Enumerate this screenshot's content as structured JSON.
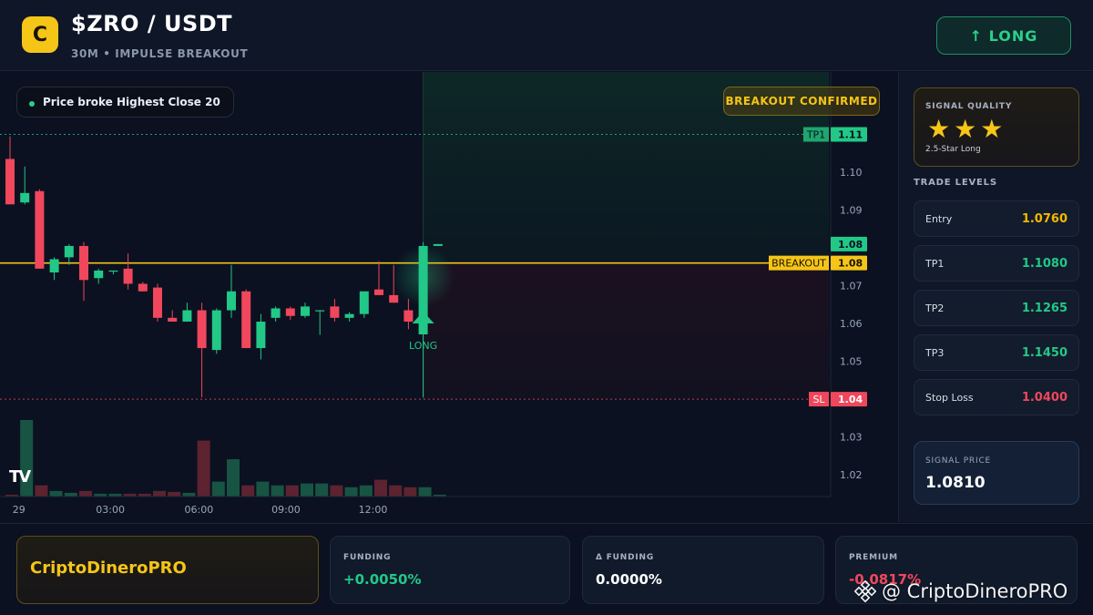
{
  "header": {
    "logo_letter": "C",
    "title": "$ZRO / USDT",
    "subtitle": "30M • IMPULSE BREAKOUT",
    "long_button": "↑ LONG"
  },
  "chart": {
    "pill_text": "Price broke Highest Close 20",
    "confirmed_badge": "BREAKOUT CONFIRMED",
    "signal_label": "LONG",
    "tv_logo": "TV",
    "colors": {
      "up": "#22c887",
      "down": "#f0475c",
      "breakout": "#f5c518"
    }
  },
  "chart_data": {
    "type": "candlestick",
    "x_ticks": [
      "29",
      "03:00",
      "06:00",
      "09:00",
      "12:00"
    ],
    "y_ticks": [
      "1.10",
      "1.09",
      "1.07",
      "1.06",
      "1.05",
      "1.03",
      "1.02"
    ],
    "ylim": [
      1.0075,
      1.1265
    ],
    "levels": [
      {
        "label": "TP1",
        "value": 1.11,
        "value_text": "1.11",
        "color": "#22c887",
        "style": "dotted"
      },
      {
        "label": "BREAKOUT",
        "value": 1.076,
        "value_text": "1.08",
        "color": "#f5c518",
        "style": "solid"
      },
      {
        "label": "SL",
        "value": 1.04,
        "value_text": "1.04",
        "color": "#f0475c",
        "style": "dotted"
      }
    ],
    "last_price_tag": {
      "value": 1.081,
      "value_text": "1.08"
    },
    "candles": [
      {
        "o": 1.1035,
        "h": 1.1095,
        "l": 1.0915,
        "c": 1.0915
      },
      {
        "o": 1.092,
        "h": 1.1015,
        "l": 1.0915,
        "c": 1.0945
      },
      {
        "o": 1.095,
        "h": 1.0955,
        "l": 1.0745,
        "c": 1.0745
      },
      {
        "o": 1.0735,
        "h": 1.0775,
        "l": 1.0715,
        "c": 1.077
      },
      {
        "o": 1.0775,
        "h": 1.081,
        "l": 1.0755,
        "c": 1.0805
      },
      {
        "o": 1.0805,
        "h": 1.0815,
        "l": 1.066,
        "c": 1.0715
      },
      {
        "o": 1.072,
        "h": 1.0745,
        "l": 1.0705,
        "c": 1.074
      },
      {
        "o": 1.074,
        "h": 1.074,
        "l": 1.073,
        "c": 1.074
      },
      {
        "o": 1.0745,
        "h": 1.0785,
        "l": 1.069,
        "c": 1.0705
      },
      {
        "o": 1.0705,
        "h": 1.071,
        "l": 1.0685,
        "c": 1.0685
      },
      {
        "o": 1.0695,
        "h": 1.0705,
        "l": 1.0605,
        "c": 1.0615
      },
      {
        "o": 1.0615,
        "h": 1.0635,
        "l": 1.0605,
        "c": 1.0605
      },
      {
        "o": 1.0605,
        "h": 1.0655,
        "l": 1.0605,
        "c": 1.0635
      },
      {
        "o": 1.0635,
        "h": 1.0655,
        "l": 1.0405,
        "c": 1.0535
      },
      {
        "o": 1.053,
        "h": 1.064,
        "l": 1.052,
        "c": 1.0635
      },
      {
        "o": 1.0635,
        "h": 1.0755,
        "l": 1.0615,
        "c": 1.0685
      },
      {
        "o": 1.0685,
        "h": 1.069,
        "l": 1.0535,
        "c": 1.0535
      },
      {
        "o": 1.0535,
        "h": 1.0625,
        "l": 1.0505,
        "c": 1.0605
      },
      {
        "o": 1.0615,
        "h": 1.0645,
        "l": 1.0605,
        "c": 1.064
      },
      {
        "o": 1.064,
        "h": 1.0645,
        "l": 1.061,
        "c": 1.062
      },
      {
        "o": 1.062,
        "h": 1.0655,
        "l": 1.0615,
        "c": 1.0645
      },
      {
        "o": 1.0635,
        "h": 1.0635,
        "l": 1.057,
        "c": 1.0635
      },
      {
        "o": 1.0645,
        "h": 1.0665,
        "l": 1.0605,
        "c": 1.0615
      },
      {
        "o": 1.0615,
        "h": 1.063,
        "l": 1.0605,
        "c": 1.0625
      },
      {
        "o": 1.0625,
        "h": 1.0685,
        "l": 1.0615,
        "c": 1.0685
      },
      {
        "o": 1.069,
        "h": 1.0765,
        "l": 1.0675,
        "c": 1.0675
      },
      {
        "o": 1.0675,
        "h": 1.0755,
        "l": 1.0655,
        "c": 1.0655
      },
      {
        "o": 1.0635,
        "h": 1.0665,
        "l": 1.0585,
        "c": 1.0605
      },
      {
        "o": 1.0615,
        "h": 1.0815,
        "l": 1.0405,
        "c": 1.0805
      },
      {
        "o": 1.0805,
        "h": 1.081,
        "l": 1.0805,
        "c": 1.081
      }
    ],
    "volume": [
      {
        "v": 2,
        "up": false
      },
      {
        "v": 82,
        "up": true
      },
      {
        "v": 12,
        "up": false
      },
      {
        "v": 6,
        "up": true
      },
      {
        "v": 4,
        "up": true
      },
      {
        "v": 6,
        "up": false
      },
      {
        "v": 3,
        "up": true
      },
      {
        "v": 3,
        "up": true
      },
      {
        "v": 3,
        "up": false
      },
      {
        "v": 3,
        "up": false
      },
      {
        "v": 6,
        "up": false
      },
      {
        "v": 5,
        "up": false
      },
      {
        "v": 4,
        "up": true
      },
      {
        "v": 60,
        "up": false
      },
      {
        "v": 16,
        "up": true
      },
      {
        "v": 40,
        "up": true
      },
      {
        "v": 12,
        "up": false
      },
      {
        "v": 16,
        "up": true
      },
      {
        "v": 12,
        "up": true
      },
      {
        "v": 12,
        "up": false
      },
      {
        "v": 14,
        "up": true
      },
      {
        "v": 14,
        "up": true
      },
      {
        "v": 12,
        "up": false
      },
      {
        "v": 10,
        "up": true
      },
      {
        "v": 12,
        "up": true
      },
      {
        "v": 18,
        "up": false
      },
      {
        "v": 12,
        "up": false
      },
      {
        "v": 10,
        "up": false
      },
      {
        "v": 10,
        "up": true
      },
      {
        "v": 2,
        "up": true
      }
    ]
  },
  "sidebar": {
    "quality_label": "SIGNAL QUALITY",
    "stars": "★★★",
    "quality_sub": "2.5-Star Long",
    "levels_title": "TRADE LEVELS",
    "levels": [
      {
        "name": "Entry",
        "value": "1.0760",
        "color": "#f5b700"
      },
      {
        "name": "TP1",
        "value": "1.1080",
        "color": "#22c887"
      },
      {
        "name": "TP2",
        "value": "1.1265",
        "color": "#22c887"
      },
      {
        "name": "TP3",
        "value": "1.1450",
        "color": "#22c887"
      },
      {
        "name": "Stop Loss",
        "value": "1.0400",
        "color": "#f0475c"
      }
    ],
    "signal_price_label": "SIGNAL PRICE",
    "signal_price": "1.0810"
  },
  "footer": {
    "brand": "CriptoDineroPRO",
    "funding_label": "FUNDING",
    "funding_value": "+0.0050%",
    "dfunding_label": "Δ FUNDING",
    "dfunding_value": "0.0000%",
    "premium_label": "PREMIUM",
    "premium_value": "-0.0817%",
    "watermark": "@ CriptoDineroPRO"
  }
}
